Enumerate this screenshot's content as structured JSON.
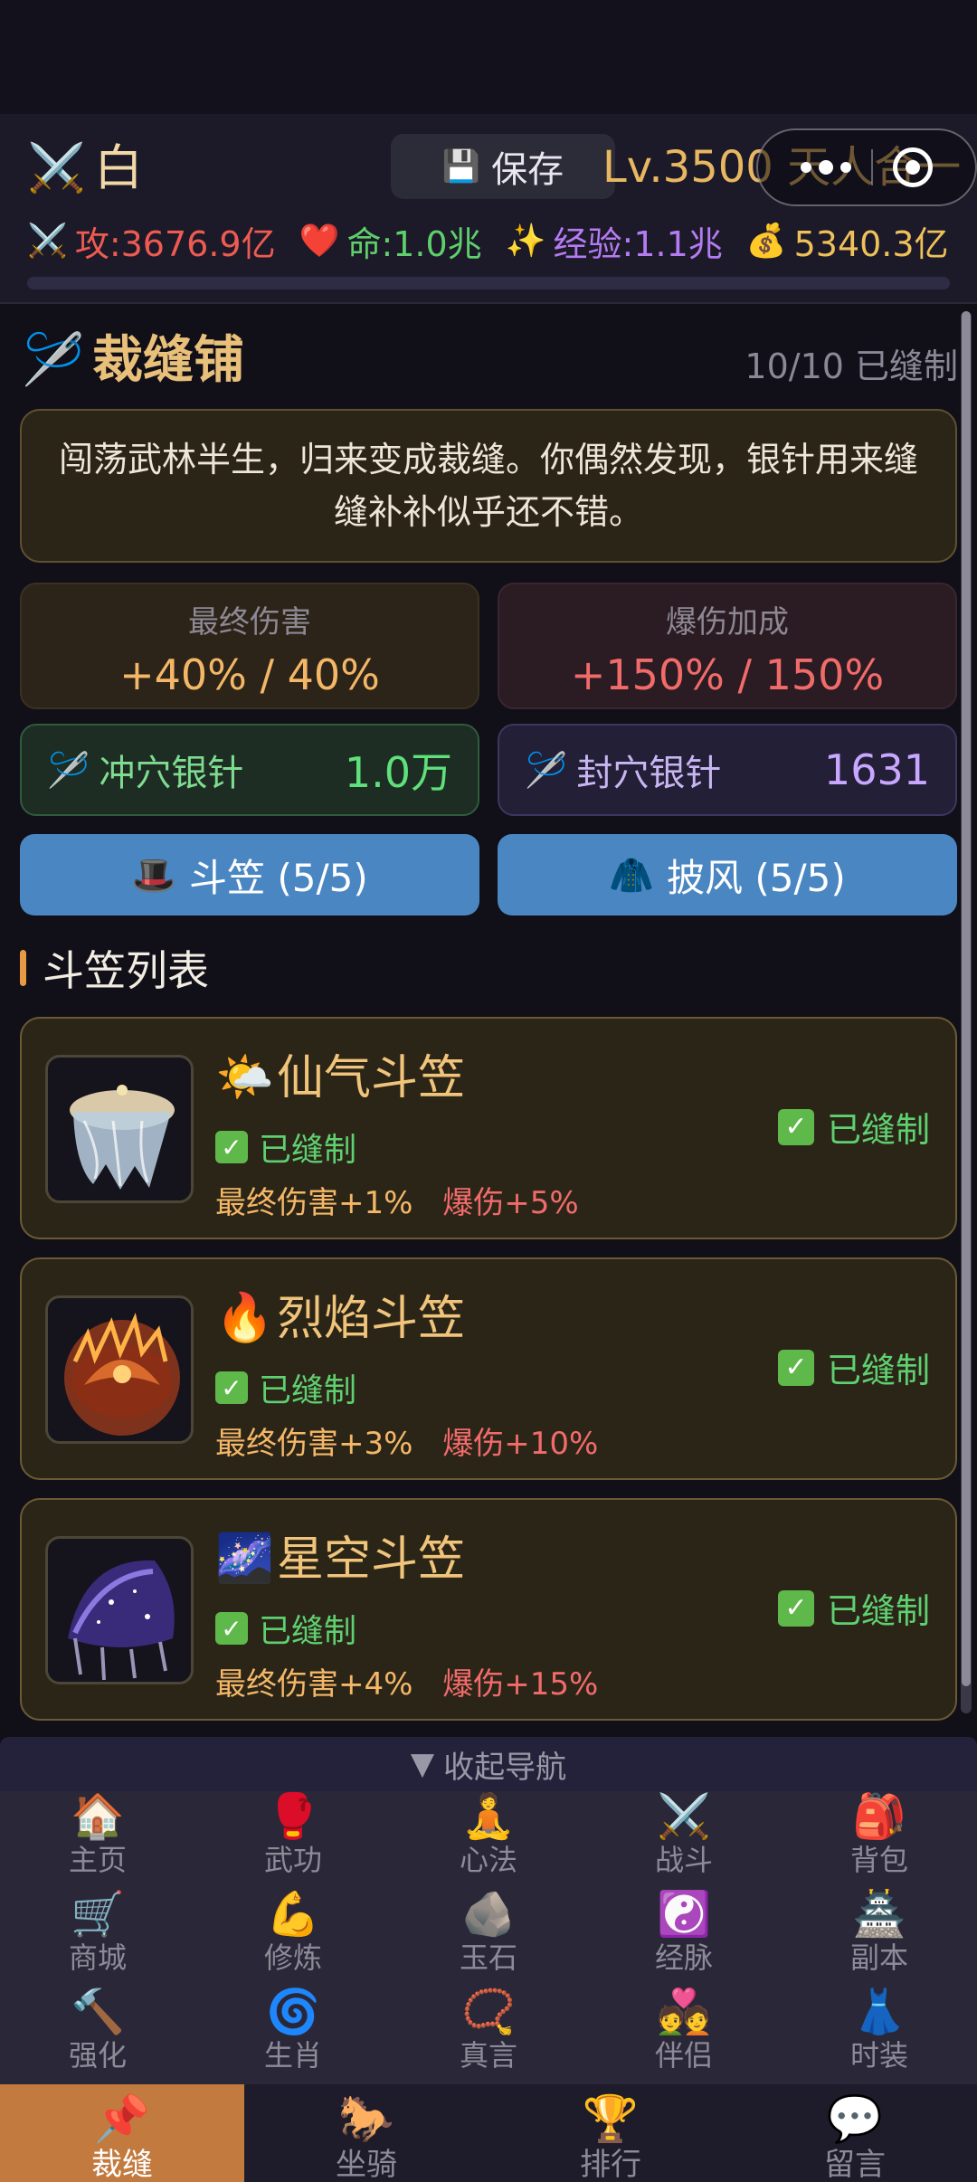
{
  "header": {
    "player_icon": "⚔️",
    "player_name": "白",
    "save_icon": "💾",
    "save_label": "保存",
    "level": "Lv.3500 天人合一",
    "stats": {
      "attack": {
        "icon": "⚔️",
        "text": "攻:3676.9亿"
      },
      "life": {
        "icon": "❤️",
        "text": "命:1.0兆"
      },
      "exp": {
        "icon": "✨",
        "text": "经验:1.1兆"
      },
      "gold": {
        "icon": "💰",
        "text": "5340.3亿"
      }
    },
    "progress_fraction": 0.0
  },
  "shop": {
    "icon": "🪡",
    "title": "裁缝铺",
    "count": "10/10 已缝制",
    "description": "闯荡武林半生，归来变成裁缝。你偶然发现，银针用来缝缝补补似乎还不错。",
    "final_damage": {
      "label": "最终伤害",
      "value": "+40% / 40%"
    },
    "crit_bonus": {
      "label": "爆伤加成",
      "value": "+150% / 150%"
    },
    "chong_needle": {
      "icon": "🪡",
      "label": "冲穴银针",
      "value": "1.0万"
    },
    "feng_needle": {
      "icon": "🪡",
      "label": "封穴银针",
      "value": "1631"
    },
    "tabs": {
      "hat": {
        "icon": "🎩",
        "label": "斗笠 (5/5)"
      },
      "cape": {
        "icon": "🧥",
        "label": "披风 (5/5)"
      }
    },
    "list_title": "斗笠列表",
    "items": [
      {
        "emoji": "🌤️",
        "name": "仙气斗笠",
        "status": "已缝制",
        "effect1": "最终伤害+1%",
        "effect2": "爆伤+5%",
        "right_status": "已缝制"
      },
      {
        "emoji": "🔥",
        "name": "烈焰斗笠",
        "status": "已缝制",
        "effect1": "最终伤害+3%",
        "effect2": "爆伤+10%",
        "right_status": "已缝制"
      },
      {
        "emoji": "🌌",
        "name": "星空斗笠",
        "status": "已缝制",
        "effect1": "最终伤害+4%",
        "effect2": "爆伤+15%",
        "right_status": "已缝制"
      }
    ],
    "check_mark": "✓"
  },
  "nav": {
    "collapse_icon": "▼",
    "collapse_label": "收起导航",
    "grid": [
      {
        "icon": "🏠",
        "label": "主页"
      },
      {
        "icon": "🥊",
        "label": "武功"
      },
      {
        "icon": "🧘",
        "label": "心法"
      },
      {
        "icon": "⚔️",
        "label": "战斗"
      },
      {
        "icon": "🎒",
        "label": "背包"
      },
      {
        "icon": "🛒",
        "label": "商城"
      },
      {
        "icon": "💪",
        "label": "修炼"
      },
      {
        "icon": "🪨",
        "label": "玉石"
      },
      {
        "icon": "☯️",
        "label": "经脉"
      },
      {
        "icon": "🏯",
        "label": "副本"
      },
      {
        "icon": "🔨",
        "label": "强化"
      },
      {
        "icon": "🌀",
        "label": "生肖"
      },
      {
        "icon": "📿",
        "label": "真言"
      },
      {
        "icon": "💑",
        "label": "伴侣"
      },
      {
        "icon": "👗",
        "label": "时装"
      }
    ],
    "tabs": [
      {
        "icon": "📌",
        "label": "裁缝",
        "active": true
      },
      {
        "icon": "🐎",
        "label": "坐骑",
        "active": false
      },
      {
        "icon": "🏆",
        "label": "排行",
        "active": false
      },
      {
        "icon": "💬",
        "label": "留言",
        "active": false
      }
    ]
  },
  "colors": {
    "accent_gold": "#e8c07a",
    "tab_blue": "#4a87c2",
    "active_tab": "#c27a3e",
    "status_green": "#5fd070"
  }
}
